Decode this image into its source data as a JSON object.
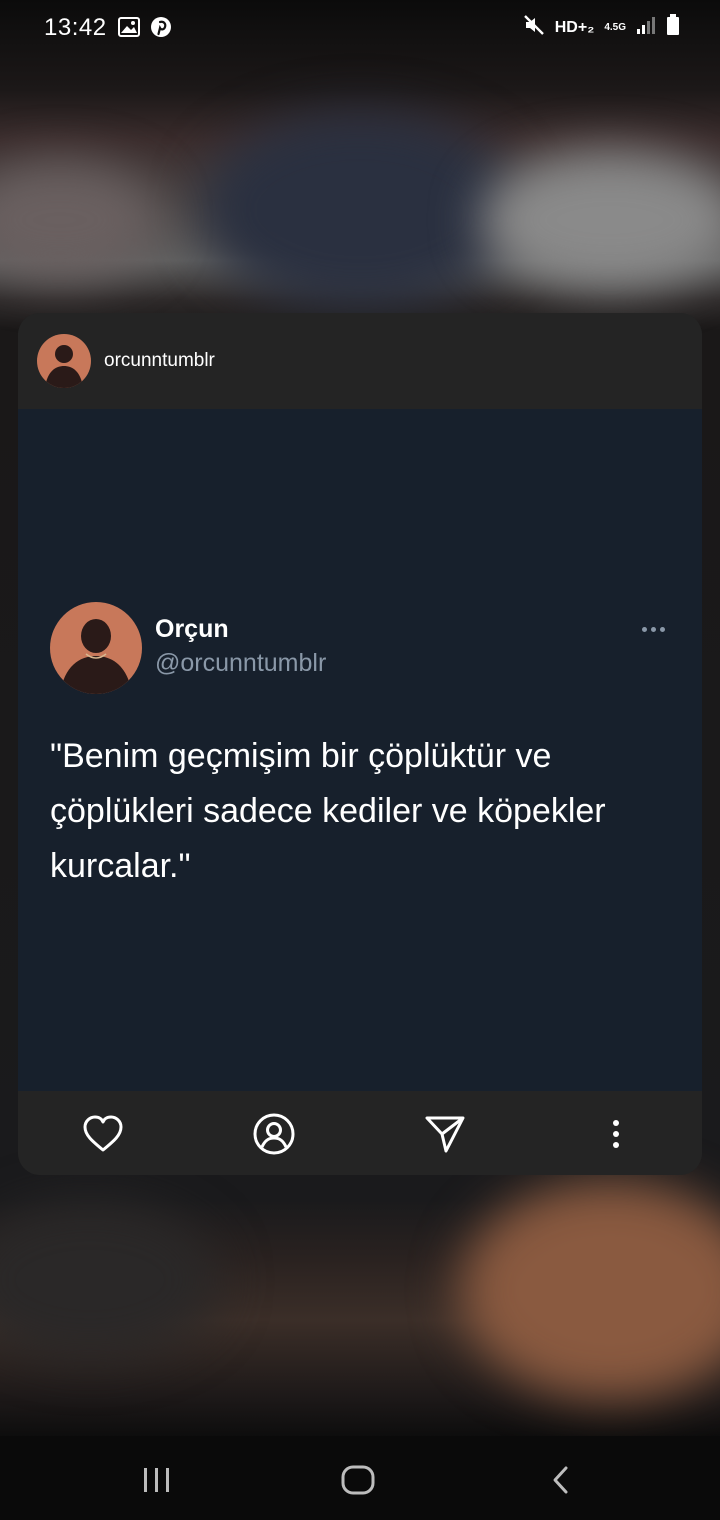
{
  "status_bar": {
    "time": "13:42",
    "network": "HD+₂",
    "network_type": "4.5G",
    "left_icons": [
      "gallery-icon",
      "pinterest-icon"
    ],
    "right_icons": [
      "mute-icon",
      "signal-icon",
      "battery-icon"
    ]
  },
  "card": {
    "header": {
      "username": "orcunntumblr"
    },
    "tweet": {
      "display_name": "Orçun",
      "handle": "@orcunntumblr",
      "text": "\"Benim geçmişim bir çöplüktür ve çöplükleri sadece kediler ve köpekler kurcalar.\""
    },
    "actions": [
      "heart-icon",
      "profile-icon",
      "send-icon",
      "more-vertical-icon"
    ]
  },
  "nav": {
    "buttons": [
      "recent-apps-icon",
      "home-icon",
      "back-icon"
    ]
  },
  "colors": {
    "card_header_bg": "#242424",
    "tweet_bg": "#17202c",
    "handle_color": "#8a98a8"
  }
}
